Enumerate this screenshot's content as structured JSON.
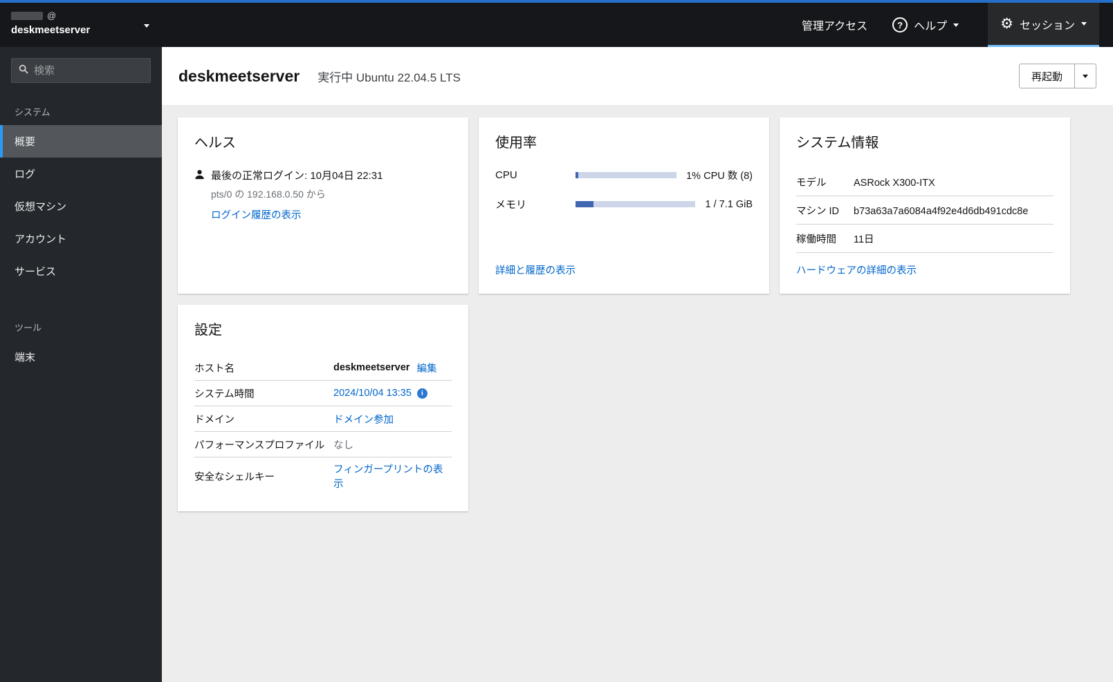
{
  "colors": {
    "accent_blue": "#2470c8",
    "link_blue": "#0066cc",
    "nav_active_border": "#2b9af3",
    "session_underline": "#73bcf7",
    "progress_fill": "#4166b0",
    "progress_track": "#ccd6e8"
  },
  "masthead": {
    "user_at": "@",
    "hostname": "deskmeetserver",
    "admin_access": "管理アクセス",
    "help": "ヘルプ",
    "help_icon_glyph": "?",
    "session": "セッション",
    "gear_glyph": "⚙"
  },
  "sidebar": {
    "search_placeholder": "検索",
    "sections": [
      {
        "label": "システム",
        "items": [
          {
            "label": "概要",
            "active": true
          },
          {
            "label": "ログ"
          },
          {
            "label": "仮想マシン"
          },
          {
            "label": "アカウント"
          },
          {
            "label": "サービス"
          }
        ]
      },
      {
        "label": "ツール",
        "items": [
          {
            "label": "端末"
          }
        ]
      }
    ]
  },
  "header": {
    "hostname": "deskmeetserver",
    "status": "実行中 Ubuntu 22.04.5 LTS",
    "restart": "再起動"
  },
  "cards": {
    "health": {
      "title": "ヘルス",
      "last_login": "最後の正常ログイン: 10月04日 22:31",
      "login_source": "pts/0 の 192.168.0.50 から",
      "login_history_link": "ログイン履歴の表示"
    },
    "usage": {
      "title": "使用率",
      "cpu_label": "CPU",
      "cpu_value": "1% CPU 数 (8)",
      "cpu_percent": 3,
      "memory_label": "メモリ",
      "memory_value": "1 / 7.1 GiB",
      "memory_percent": 15,
      "details_link": "詳細と履歴の表示"
    },
    "sysinfo": {
      "title": "システム情報",
      "rows": [
        {
          "label": "モデル",
          "value": "ASRock X300-ITX"
        },
        {
          "label": "マシン ID",
          "value": "b73a63a7a6084a4f92e4d6db491cdc8e"
        },
        {
          "label": "稼働時間",
          "value": "11日"
        }
      ],
      "hardware_link": "ハードウェアの詳細の表示"
    },
    "config": {
      "title": "設定",
      "hostname_label": "ホスト名",
      "hostname_value": "deskmeetserver",
      "hostname_edit": "編集",
      "time_label": "システム時間",
      "time_value": "2024/10/04 13:35",
      "time_info_glyph": "i",
      "domain_label": "ドメイン",
      "domain_value": "ドメイン参加",
      "profile_label": "パフォーマンスプロファイル",
      "profile_value": "なし",
      "ssh_label": "安全なシェルキー",
      "ssh_value": "フィンガープリントの表示"
    }
  }
}
